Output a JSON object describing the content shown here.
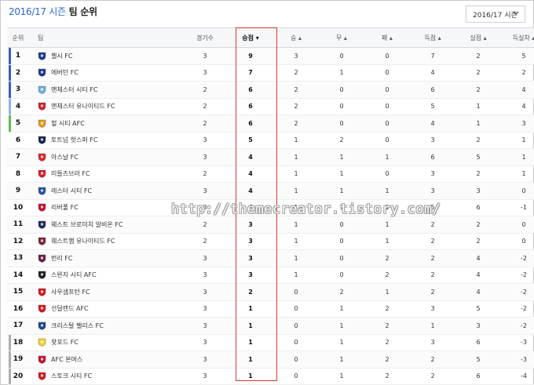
{
  "header": {
    "title_accent": "2016/17 시즌",
    "title_main": "팀 순위",
    "season_value": "2016/17 시즌"
  },
  "columns": [
    "순위",
    "팀",
    "경기수",
    "승점 ▾",
    "승 ▴",
    "무 ▴",
    "패 ▴",
    "득점 ▴",
    "실점 ▴",
    "득실차 ▴"
  ],
  "colors": {
    "accent": "#2a69c9",
    "highlight": "#e0362c",
    "rank_bar_dark": "#3461c1",
    "rank_bar_light": "#8ab4e8",
    "rank_bar_green": "#66bb55",
    "rank_bar_gray": "#aeaeae"
  },
  "rows": [
    {
      "rank": "1",
      "team": "첼시 FC",
      "gp": "3",
      "pts": "9",
      "w": "3",
      "d": "0",
      "l": "0",
      "gf": "7",
      "ga": "2",
      "gd": "5",
      "bar": "#3461c1",
      "crest": "#1a3b8f",
      "icon": "chelsea-crest-icon"
    },
    {
      "rank": "2",
      "team": "에버턴 FC",
      "gp": "3",
      "pts": "7",
      "w": "2",
      "d": "1",
      "l": "0",
      "gf": "4",
      "ga": "2",
      "gd": "2",
      "bar": "#3461c1",
      "crest": "#1b3a8c",
      "icon": "everton-crest-icon"
    },
    {
      "rank": "3",
      "team": "맨체스터 시티 FC",
      "gp": "2",
      "pts": "6",
      "w": "2",
      "d": "0",
      "l": "0",
      "gf": "6",
      "ga": "2",
      "gd": "4",
      "bar": "#3461c1",
      "crest": "#6ab0e0",
      "icon": "man-city-crest-icon"
    },
    {
      "rank": "4",
      "team": "맨체스터 유나이티드 FC",
      "gp": "2",
      "pts": "6",
      "w": "2",
      "d": "0",
      "l": "0",
      "gf": "5",
      "ga": "1",
      "gd": "4",
      "bar": "#8ab4e8",
      "crest": "#d6202b",
      "icon": "man-united-crest-icon"
    },
    {
      "rank": "5",
      "team": "헐 시티 AFC",
      "gp": "2",
      "pts": "6",
      "w": "2",
      "d": "0",
      "l": "0",
      "gf": "4",
      "ga": "1",
      "gd": "3",
      "bar": "#66bb55",
      "crest": "#e59b1b",
      "icon": "hull-city-crest-icon"
    },
    {
      "rank": "6",
      "team": "토트넘 핫스퍼 FC",
      "gp": "3",
      "pts": "5",
      "w": "1",
      "d": "2",
      "l": "0",
      "gf": "3",
      "ga": "2",
      "gd": "1",
      "bar": "",
      "crest": "#1a2450",
      "icon": "tottenham-crest-icon"
    },
    {
      "rank": "7",
      "team": "아스날 FC",
      "gp": "3",
      "pts": "4",
      "w": "1",
      "d": "1",
      "l": "1",
      "gf": "6",
      "ga": "5",
      "gd": "1",
      "bar": "",
      "crest": "#d9262a",
      "icon": "arsenal-crest-icon"
    },
    {
      "rank": "8",
      "team": "미들즈브러 FC",
      "gp": "2",
      "pts": "4",
      "w": "1",
      "d": "1",
      "l": "0",
      "gf": "3",
      "ga": "2",
      "gd": "1",
      "bar": "",
      "crest": "#d8202c",
      "icon": "middlesbrough-crest-icon"
    },
    {
      "rank": "9",
      "team": "레스터 시티 FC",
      "gp": "3",
      "pts": "4",
      "w": "1",
      "d": "1",
      "l": "1",
      "gf": "3",
      "ga": "3",
      "gd": "0",
      "bar": "",
      "crest": "#2a4ea3",
      "icon": "leicester-crest-icon"
    },
    {
      "rank": "10",
      "team": "리버풀 FC",
      "gp": "3",
      "pts": "4",
      "w": "1",
      "d": "1",
      "l": "1",
      "gf": "5",
      "ga": "6",
      "gd": "-1",
      "bar": "",
      "crest": "#c8102e",
      "icon": "liverpool-crest-icon"
    },
    {
      "rank": "11",
      "team": "웨스트 브로미치 알비온 FC",
      "gp": "2",
      "pts": "3",
      "w": "1",
      "d": "0",
      "l": "1",
      "gf": "2",
      "ga": "2",
      "gd": "0",
      "bar": "",
      "crest": "#1b2a58",
      "icon": "west-brom-crest-icon"
    },
    {
      "rank": "12",
      "team": "웨스트햄 유나이티드 FC",
      "gp": "2",
      "pts": "3",
      "w": "1",
      "d": "0",
      "l": "1",
      "gf": "2",
      "ga": "2",
      "gd": "0",
      "bar": "",
      "crest": "#7a2636",
      "icon": "west-ham-crest-icon"
    },
    {
      "rank": "13",
      "team": "번리 FC",
      "gp": "3",
      "pts": "3",
      "w": "1",
      "d": "0",
      "l": "2",
      "gf": "2",
      "ga": "4",
      "gd": "-2",
      "bar": "",
      "crest": "#6c1d45",
      "icon": "burnley-crest-icon"
    },
    {
      "rank": "14",
      "team": "스완지 시티 AFC",
      "gp": "3",
      "pts": "3",
      "w": "1",
      "d": "0",
      "l": "2",
      "gf": "2",
      "ga": "4",
      "gd": "-2",
      "bar": "",
      "crest": "#222222",
      "icon": "swansea-crest-icon"
    },
    {
      "rank": "15",
      "team": "사우샘프턴 FC",
      "gp": "3",
      "pts": "2",
      "w": "0",
      "d": "2",
      "l": "1",
      "gf": "2",
      "ga": "4",
      "gd": "-2",
      "bar": "",
      "crest": "#d71920",
      "icon": "southampton-crest-icon"
    },
    {
      "rank": "16",
      "team": "선덜랜드 AFC",
      "gp": "3",
      "pts": "1",
      "w": "0",
      "d": "1",
      "l": "2",
      "gf": "3",
      "ga": "5",
      "gd": "-2",
      "bar": "",
      "crest": "#d71920",
      "icon": "sunderland-crest-icon"
    },
    {
      "rank": "17",
      "team": "크리스탈 팰리스 FC",
      "gp": "3",
      "pts": "1",
      "w": "0",
      "d": "1",
      "l": "2",
      "gf": "1",
      "ga": "3",
      "gd": "-2",
      "bar": "",
      "crest": "#1b458f",
      "icon": "crystal-palace-crest-icon"
    },
    {
      "rank": "18",
      "team": "왓포드 FC",
      "gp": "3",
      "pts": "1",
      "w": "0",
      "d": "1",
      "l": "2",
      "gf": "3",
      "ga": "6",
      "gd": "-3",
      "bar": "#aeaeae",
      "crest": "#f4d12e",
      "icon": "watford-crest-icon"
    },
    {
      "rank": "19",
      "team": "AFC 본머스",
      "gp": "3",
      "pts": "1",
      "w": "0",
      "d": "1",
      "l": "2",
      "gf": "2",
      "ga": "5",
      "gd": "-3",
      "bar": "#aeaeae",
      "crest": "#c8102e",
      "icon": "bournemouth-crest-icon"
    },
    {
      "rank": "20",
      "team": "스토크 시티 FC",
      "gp": "3",
      "pts": "1",
      "w": "0",
      "d": "1",
      "l": "2",
      "gf": "2",
      "ga": "6",
      "gd": "-4",
      "bar": "#aeaeae",
      "crest": "#d71920",
      "icon": "stoke-crest-icon"
    }
  ],
  "watermark": "http://themecreator.tistory.com/"
}
